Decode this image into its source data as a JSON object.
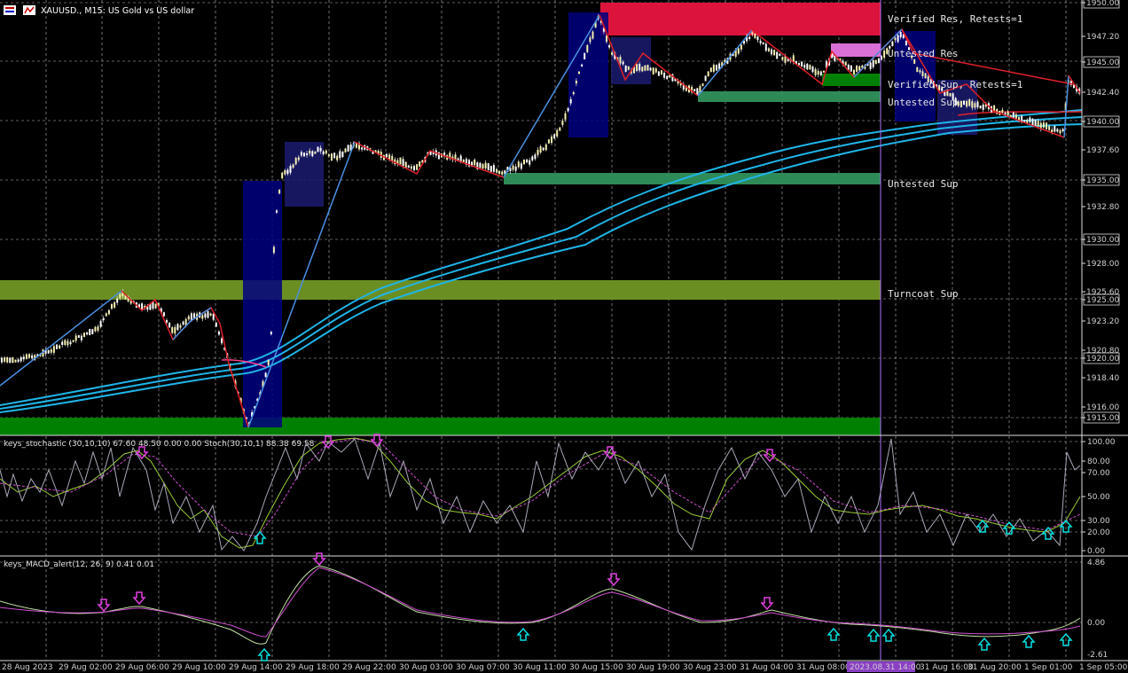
{
  "header": {
    "symbol_text": "XAUUSD., M15:  US Gold vs US dollar"
  },
  "main_price_axis": [
    "1950.00",
    "1947.20",
    "1945.00",
    "1942.40",
    "1940.00",
    "1937.60",
    "1935.00",
    "1932.80",
    "1930.00",
    "1928.00",
    "1925.60",
    "1925.00",
    "1923.20",
    "1920.80",
    "1920.00",
    "1918.40",
    "1916.00",
    "1915.00"
  ],
  "zones": [
    {
      "label": "Verified Res, Retests=1",
      "color": "#dc143c"
    },
    {
      "label": "Untested Res",
      "color": "#da70d6"
    },
    {
      "label": "Verified Sup, Retests=1",
      "color": "#008000"
    },
    {
      "label": "Untested Sup",
      "color": "#2e8b57"
    },
    {
      "label": "Untested Sup",
      "color": "#2e8b57"
    },
    {
      "label": "Turncoat Sup",
      "color": "#6b8e23"
    },
    {
      "label": "",
      "color": "#008000"
    }
  ],
  "stochastic": {
    "header": "keys_stochastic (30,10,10) 67.60 48.50 0.00 0.00 Stoch(30,10,1) 88.38 69.58",
    "axis": [
      "100.00",
      "80.00",
      "70.00",
      "50.00",
      "30.00",
      "20.00",
      "0.00"
    ]
  },
  "macd": {
    "header": "keys_MACD_alert(12, 26, 9) 0.41 0.01",
    "axis": [
      "4.86",
      "0.00",
      "-2.61"
    ]
  },
  "time_axis": [
    "28 Aug 2023",
    "29 Aug 02:00",
    "29 Aug 06:00",
    "29 Aug 10:00",
    "29 Aug 14:00",
    "29 Aug 18:00",
    "29 Aug 22:00",
    "30 Aug 03:00",
    "30 Aug 07:00",
    "30 Aug 11:00",
    "30 Aug 15:00",
    "30 Aug 19:00",
    "30 Aug 23:00",
    "31 Aug 04:00",
    "31 Aug 08:00",
    "2023.08.31 14:00",
    "31 Aug 16:00",
    "31 Aug 20:00",
    "1 Sep 01:00",
    "1 Sep 05:00"
  ],
  "crosshair_time": "2023.08.31 14:00",
  "colors": {
    "background": "#000000",
    "grid": "#c0c0c0",
    "zigzag_up": "#4a90e2",
    "zigzag_down": "#e0202a",
    "ema": "#1fb5e8",
    "candle": "#f5f0b0",
    "box": "#000080",
    "stoch_main": "#b0b0b0",
    "stoch_signal": "#d050d0",
    "macd_main": "#c0e0a0",
    "macd_signal": "#d050d0",
    "arrow_down": "#e040e0",
    "arrow_up": "#00e0e0"
  }
}
